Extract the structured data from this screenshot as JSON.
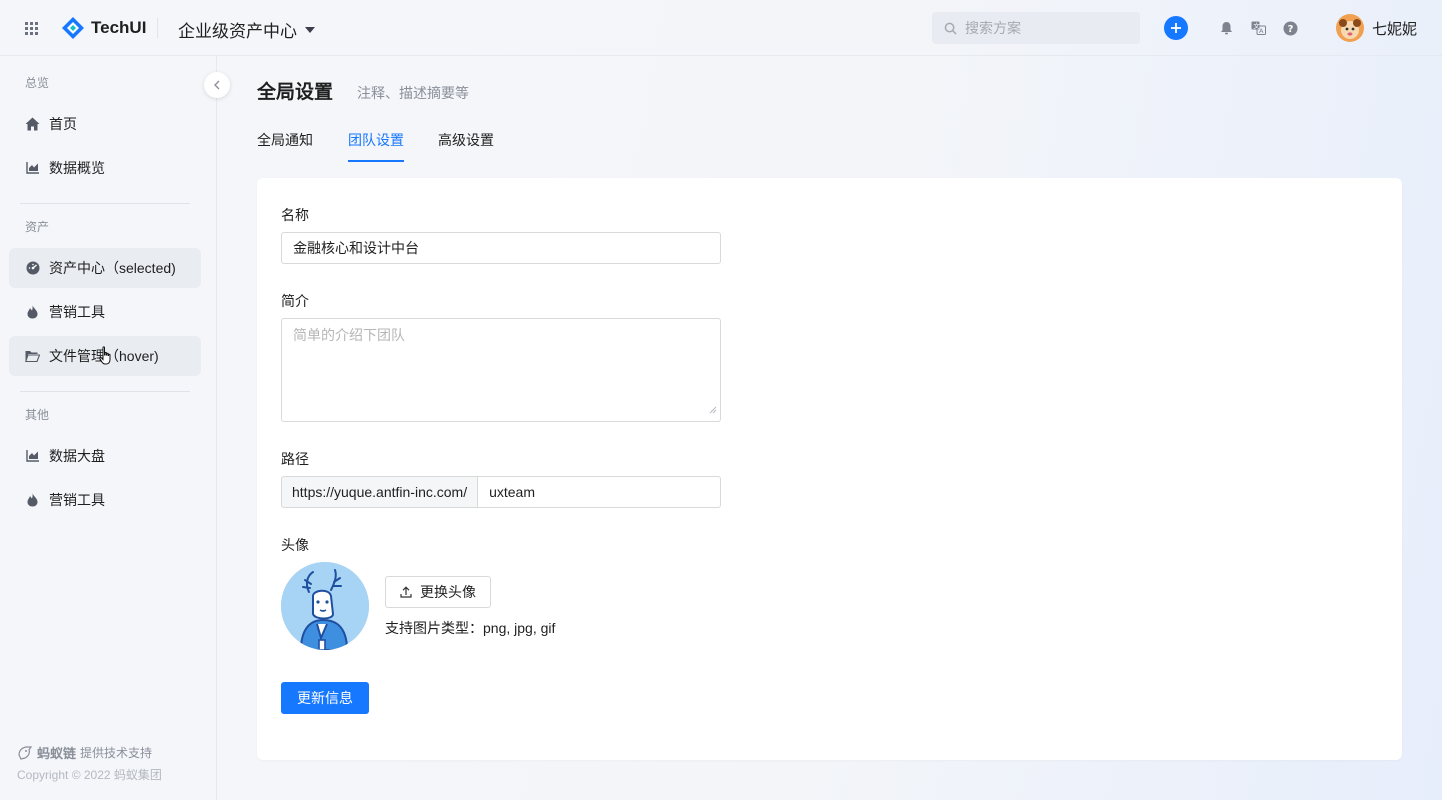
{
  "header": {
    "logo_text": "TechUI",
    "app_title": "企业级资产中心",
    "search_placeholder": "搜索方案",
    "user_name": "七妮妮"
  },
  "sidebar": {
    "groups": [
      {
        "title": "总览",
        "items": [
          {
            "label": "首页",
            "icon": "home-icon"
          },
          {
            "label": "数据概览",
            "icon": "chart-icon"
          }
        ]
      },
      {
        "title": "资产",
        "items": [
          {
            "label": "资产中心（selected)",
            "icon": "dashboard-icon"
          },
          {
            "label": "营销工具",
            "icon": "fire-icon"
          },
          {
            "label": "文件管理（hover)",
            "icon": "folder-icon"
          }
        ]
      },
      {
        "title": "其他",
        "items": [
          {
            "label": "数据大盘",
            "icon": "chart-icon"
          },
          {
            "label": "营销工具",
            "icon": "fire-icon"
          }
        ]
      }
    ],
    "footer_brand": "蚂蚁链",
    "footer_support": "提供技术支持",
    "copyright": "Copyright © 2022 蚂蚁集团"
  },
  "page": {
    "title": "全局设置",
    "subtitle": "注释、描述摘要等",
    "tabs": [
      {
        "label": "全局通知",
        "active": false
      },
      {
        "label": "团队设置",
        "active": true
      },
      {
        "label": "高级设置",
        "active": false
      }
    ]
  },
  "form": {
    "name_label": "名称",
    "name_value": "金融核心和设计中台",
    "intro_label": "简介",
    "intro_placeholder": "简单的介绍下团队",
    "path_label": "路径",
    "path_prefix": "https://yuque.antfin-inc.com/",
    "path_value": "uxteam",
    "avatar_label": "头像",
    "upload_button": "更换头像",
    "upload_hint": "支持图片类型：png, jpg, gif",
    "submit_button": "更新信息"
  },
  "colors": {
    "primary": "#1677ff",
    "selected_bg": "#e9ecf1",
    "avatar_bg": "#a7d3f5"
  }
}
